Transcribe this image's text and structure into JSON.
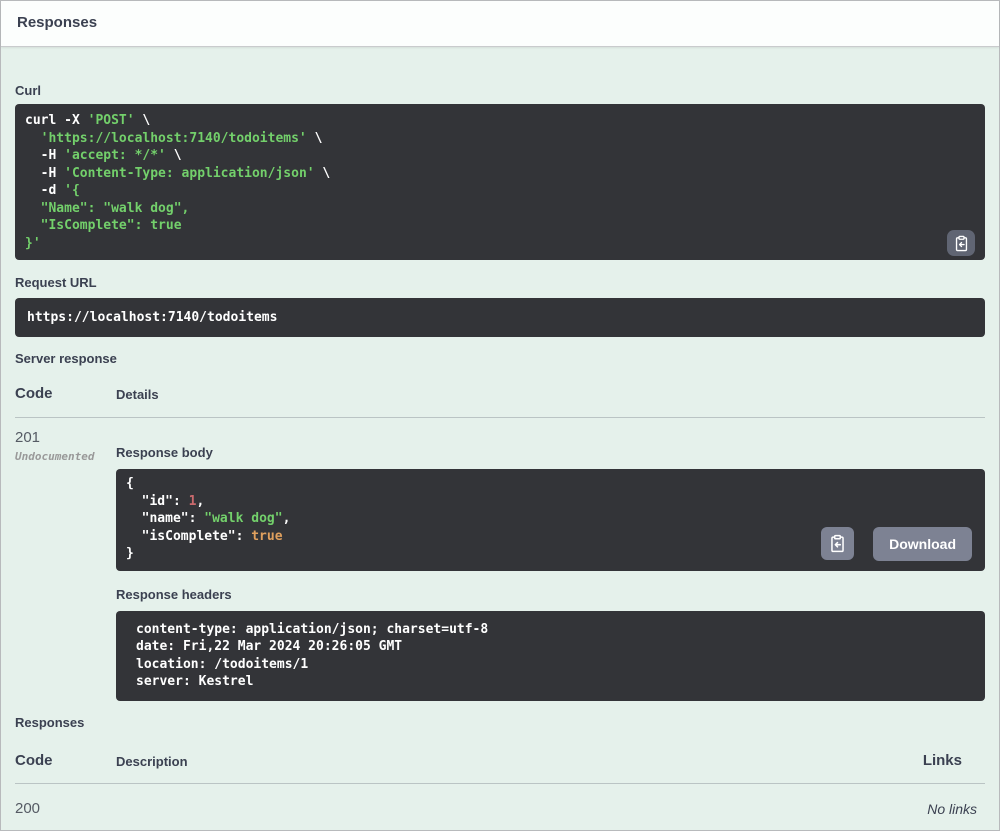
{
  "header": {
    "title": "Responses"
  },
  "colors": {
    "accent_bg": "#e5f1eb",
    "code_bg": "#333438",
    "string_green": "#73d06b",
    "number_red": "#cb6a6d",
    "boolean_orange": "#e0a05e",
    "button_grey": "#7d8293",
    "label_navy": "#3b4151"
  },
  "icons": {
    "copy": "clipboard-copy-icon"
  },
  "curl": {
    "label": "Curl",
    "lines": [
      [
        {
          "t": "curl -X ",
          "c": "plain"
        },
        {
          "t": "'POST'",
          "c": "string"
        },
        {
          "t": " \\",
          "c": "plain"
        }
      ],
      [
        {
          "t": "  ",
          "c": "plain"
        },
        {
          "t": "'https://localhost:7140/todoitems'",
          "c": "string"
        },
        {
          "t": " \\",
          "c": "plain"
        }
      ],
      [
        {
          "t": "  -H ",
          "c": "plain"
        },
        {
          "t": "'accept: */*'",
          "c": "string"
        },
        {
          "t": " \\",
          "c": "plain"
        }
      ],
      [
        {
          "t": "  -H ",
          "c": "plain"
        },
        {
          "t": "'Content-Type: application/json'",
          "c": "string"
        },
        {
          "t": " \\",
          "c": "plain"
        }
      ],
      [
        {
          "t": "  -d ",
          "c": "plain"
        },
        {
          "t": "'{",
          "c": "string"
        }
      ],
      [
        {
          "t": "  \"Name\": \"walk dog\",",
          "c": "string"
        }
      ],
      [
        {
          "t": "  \"IsComplete\": true",
          "c": "string"
        }
      ],
      [
        {
          "t": "}'",
          "c": "string"
        }
      ]
    ]
  },
  "request_url": {
    "label": "Request URL",
    "value": "https://localhost:7140/todoitems"
  },
  "server_response": {
    "label": "Server response",
    "columns": {
      "code": "Code",
      "details": "Details"
    },
    "row": {
      "code": "201",
      "code_note": "Undocumented",
      "response_body": {
        "label": "Response body",
        "download_label": "Download",
        "lines": [
          [
            {
              "t": "{",
              "c": "plain"
            }
          ],
          [
            {
              "t": "  \"id\": ",
              "c": "plain"
            },
            {
              "t": "1",
              "c": "number"
            },
            {
              "t": ",",
              "c": "plain"
            }
          ],
          [
            {
              "t": "  \"name\": ",
              "c": "plain"
            },
            {
              "t": "\"walk dog\"",
              "c": "string"
            },
            {
              "t": ",",
              "c": "plain"
            }
          ],
          [
            {
              "t": "  \"isComplete\": ",
              "c": "plain"
            },
            {
              "t": "true",
              "c": "boolean"
            }
          ],
          [
            {
              "t": "}",
              "c": "plain"
            }
          ]
        ]
      },
      "response_headers": {
        "label": "Response headers",
        "lines": [
          [
            {
              "t": "content-type: application/json; charset=utf-8",
              "c": "plain"
            }
          ],
          [
            {
              "t": "date: Fri,22 Mar 2024 20:26:05 GMT",
              "c": "plain"
            }
          ],
          [
            {
              "t": "location: /todoitems/1",
              "c": "plain"
            }
          ],
          [
            {
              "t": "server: Kestrel",
              "c": "plain"
            }
          ]
        ]
      }
    }
  },
  "responses": {
    "label": "Responses",
    "columns": {
      "code": "Code",
      "description": "Description",
      "links": "Links"
    },
    "row": {
      "code": "200",
      "description": "",
      "links": "No links"
    }
  }
}
